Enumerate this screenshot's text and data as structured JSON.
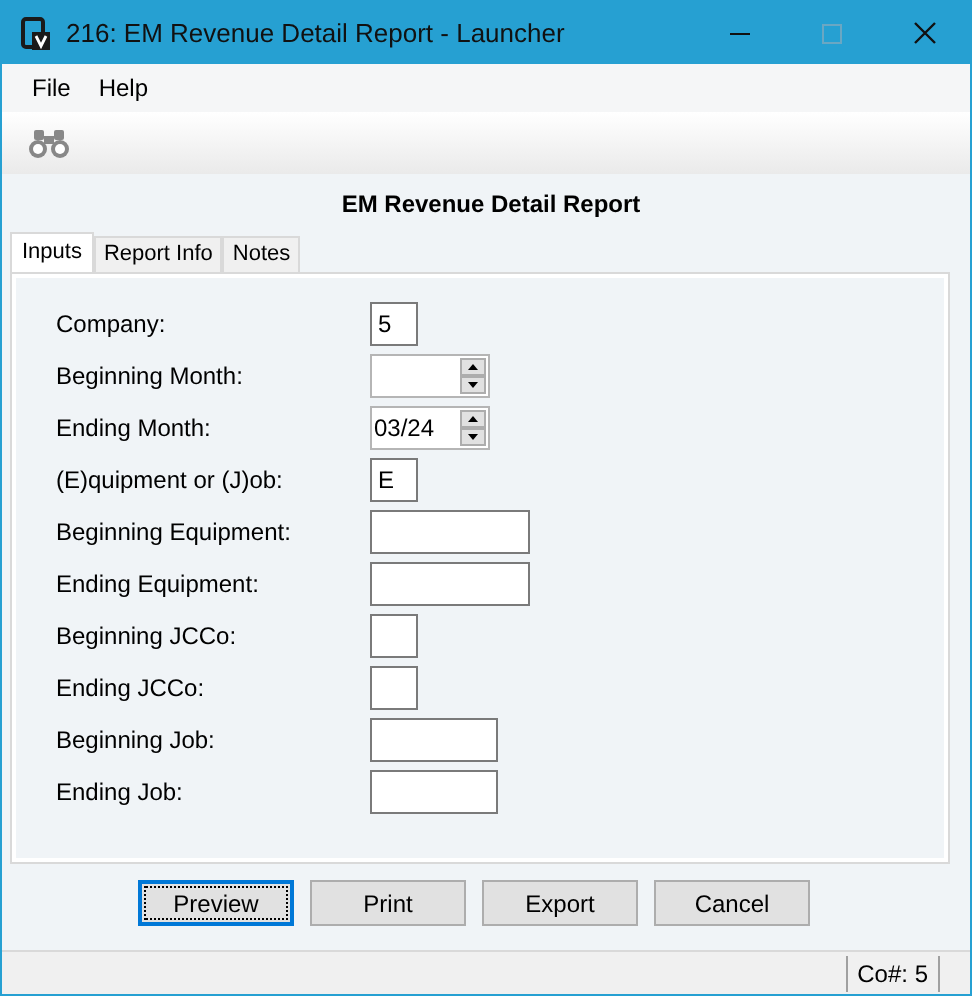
{
  "window": {
    "title": "216: EM Revenue Detail Report - Launcher"
  },
  "menu": [
    "File",
    "Help"
  ],
  "report_title": "EM Revenue Detail Report",
  "tabs": [
    {
      "label": "Inputs",
      "selected": true
    },
    {
      "label": "Report Info",
      "selected": false
    },
    {
      "label": "Notes",
      "selected": false
    }
  ],
  "fields": [
    {
      "label": "Company:",
      "kind": "code",
      "value": "5"
    },
    {
      "label": "Beginning Month:",
      "kind": "month"
    },
    {
      "label": "Ending Month:",
      "kind": "month",
      "value": "03/24"
    },
    {
      "label": "(E)quipment or (J)ob:",
      "kind": "code",
      "value": "E"
    },
    {
      "label": "Beginning Equipment:",
      "kind": "equipment"
    },
    {
      "label": "Ending Equipment:",
      "kind": "equipment"
    },
    {
      "label": "Beginning JCCo:",
      "kind": "code"
    },
    {
      "label": "Ending JCCo:",
      "kind": "code"
    },
    {
      "label": "Beginning Job:",
      "kind": "job"
    },
    {
      "label": "Ending Job:",
      "kind": "job"
    }
  ],
  "buttons": [
    {
      "label": "Preview",
      "focused": true
    },
    {
      "label": "Print",
      "focused": false
    },
    {
      "label": "Export",
      "focused": false
    },
    {
      "label": "Cancel",
      "focused": false
    }
  ],
  "status_bar": {
    "company": "Co#: 5"
  }
}
